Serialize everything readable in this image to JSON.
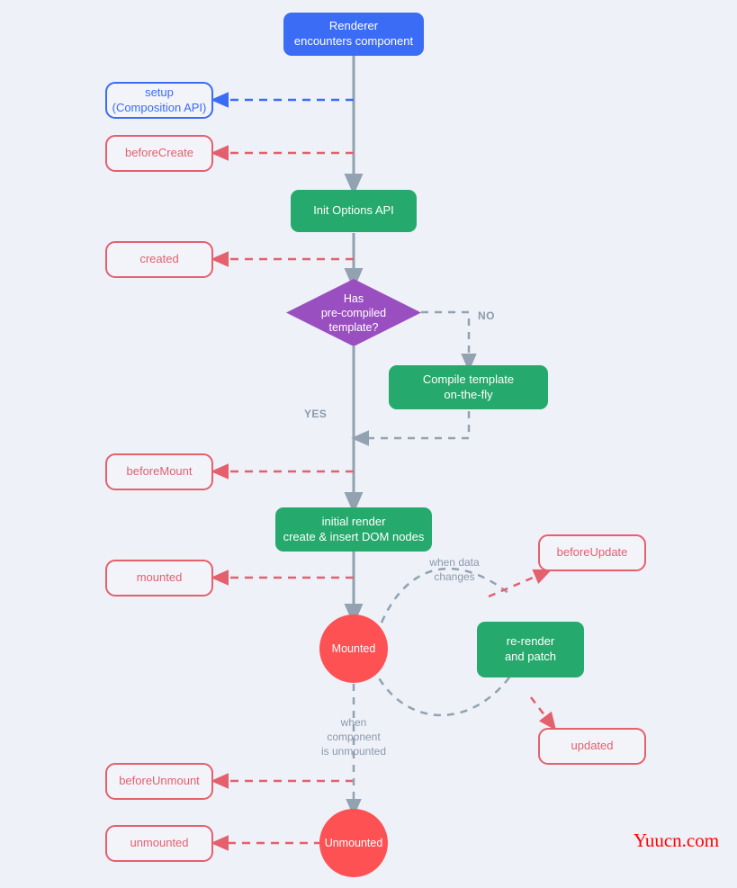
{
  "diagram": {
    "title": "Vue component lifecycle",
    "background_color": "#eef1f8",
    "colors": {
      "start": "#3b6cf6",
      "process": "#26a96c",
      "decision": "#9a4fc0",
      "state": "#fd5154",
      "hook": "#e4606d",
      "hook_composition": "#3b6cf6",
      "flow_line": "#92a2b1"
    },
    "nodes": {
      "renderer": "Renderer\nencounters component",
      "setup": "setup\n(Composition API)",
      "before_create": "beforeCreate",
      "init_options": "Init Options API",
      "created": "created",
      "decision": "Has\npre-compiled\ntemplate?",
      "compile_template": "Compile template\non-the-fly",
      "before_mount": "beforeMount",
      "initial_render": "initial render\ncreate & insert DOM nodes",
      "mounted_hook": "mounted",
      "mounted_state": "Mounted",
      "before_update": "beforeUpdate",
      "re_render": "re-render\nand patch",
      "updated": "updated",
      "before_unmount": "beforeUnmount",
      "unmounted_hook": "unmounted",
      "unmounted_state": "Unmounted"
    },
    "edge_labels": {
      "no": "NO",
      "yes": "YES",
      "when_data_changes": "when data\nchanges",
      "when_unmounted": "when\ncomponent\nis unmounted"
    },
    "watermark": "Yuucn.com"
  }
}
